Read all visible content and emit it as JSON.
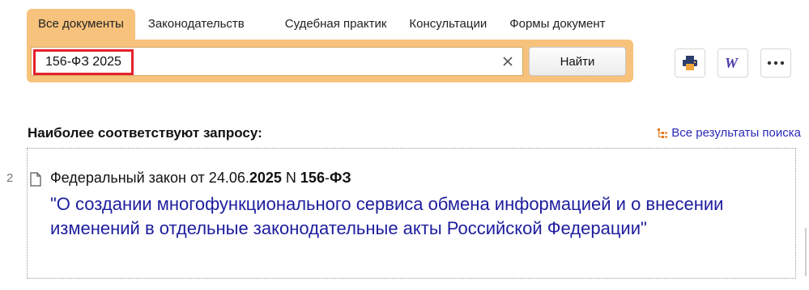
{
  "tabs": [
    {
      "label": "Все документы",
      "active": true
    },
    {
      "label": "Законодательств"
    },
    {
      "label": "Судебная практик"
    },
    {
      "label": "Консультации"
    },
    {
      "label": "Формы документ"
    }
  ],
  "search": {
    "value": "156-ФЗ 2025",
    "find_label": "Найти"
  },
  "toolbar": {
    "print_icon": "printer-icon",
    "word_icon": "word-icon",
    "more_icon": "more-dots-icon"
  },
  "results": {
    "section_title": "Наиболее соответствуют запросу:",
    "all_results_label": "Все результаты поиска",
    "items": [
      {
        "number": "2",
        "line_prefix": "Федеральный закон от 24.06.",
        "line_year": "2025",
        "line_mid": " N ",
        "line_law_num": "156",
        "line_dash": "-",
        "line_law_code": "ФЗ",
        "title": "\"О создании многофункционального сервиса обмена информацией и о внесении изменений в отдельные законодательные акты Российской Федерации\""
      }
    ]
  },
  "colors": {
    "accent": "#f7c27c",
    "highlight_border": "#e3222b",
    "link": "#1d1d9e"
  }
}
